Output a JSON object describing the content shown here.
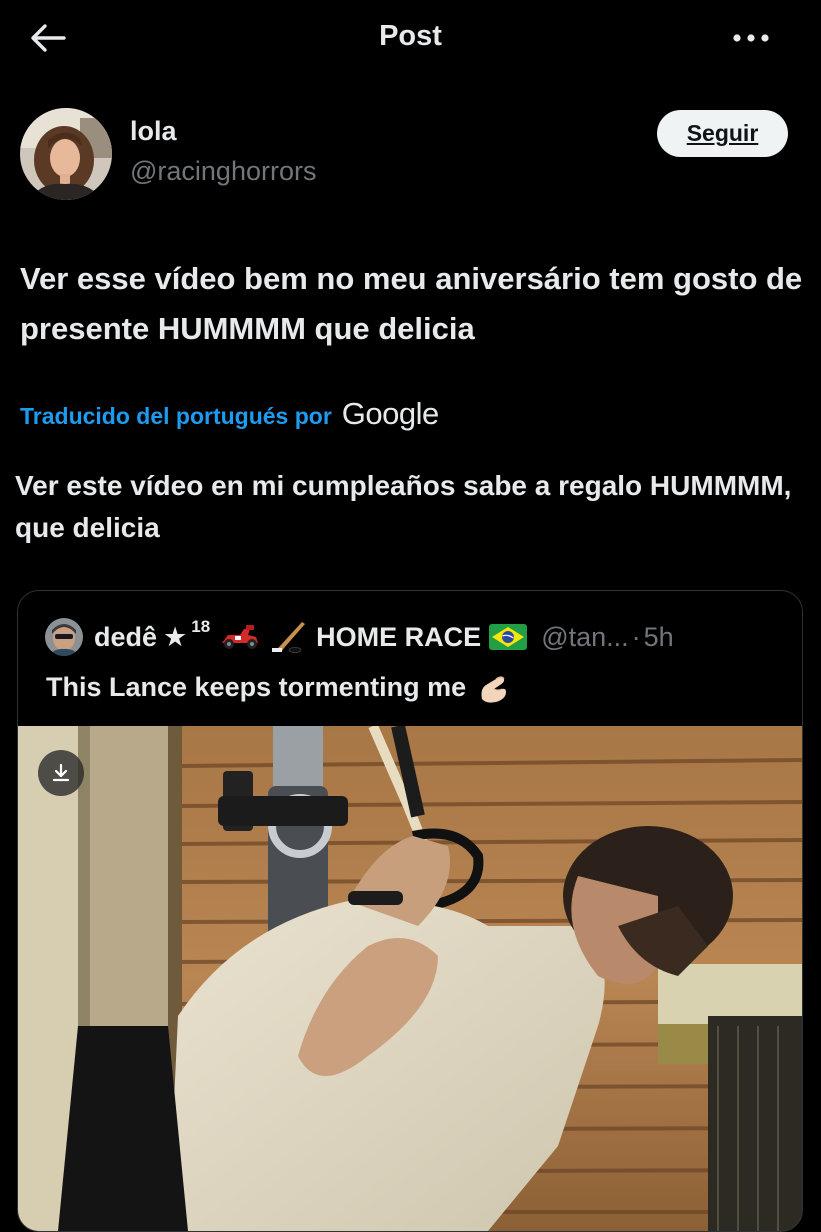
{
  "header": {
    "title": "Post",
    "back_icon": "arrow-left-icon",
    "more_icon": "more-horizontal-icon"
  },
  "post": {
    "author_name": "lola",
    "author_handle": "@racinghorrors",
    "follow_label": "Seguir",
    "text": "Ver esse vídeo bem no meu aniversário tem gosto de presente HUMMMM que delicia",
    "translated_by_label": "Traducido del portugués por",
    "translator_brand": "Google",
    "translation": "Ver este vídeo en mi cumpleaños sabe a regalo HUMMMM, que delicia"
  },
  "quote": {
    "author_name": "dedê",
    "star": "★",
    "number": "18",
    "team": "HOME RACE",
    "handle": "@tan...",
    "separator": "·",
    "time": "5h",
    "text": "This Lance keeps tormenting me",
    "emojis": [
      "racing-car-icon",
      "hockey-stick-icon",
      "brazil-flag-icon",
      "pinching-hand-icon"
    ],
    "download_icon": "download-icon"
  },
  "colors": {
    "background": "#000000",
    "text": "#e7e9ea",
    "secondary": "#71767b",
    "link": "#1d9bf0",
    "button_bg": "#eff3f4",
    "border": "#2f3336"
  }
}
